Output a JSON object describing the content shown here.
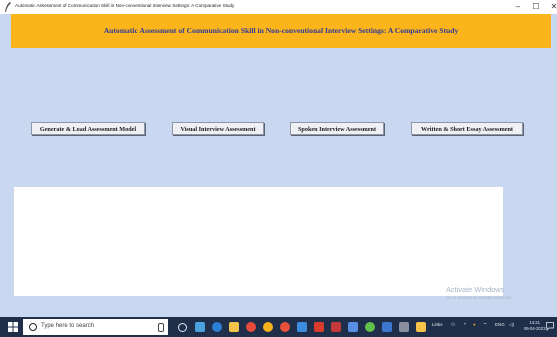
{
  "window": {
    "title": "Automatic Assessment of Communication Skill in Non-conventional Interview Settings: A Comparative Study",
    "minimize_glyph": "–",
    "maximize_glyph": "☐",
    "close_glyph": "✕"
  },
  "header": {
    "heading": "Automatic Assessment of Communication Skill in Non-conventional Interview Settings: A Comparative Study"
  },
  "buttons": {
    "generate_load": "Generate & Load Assessment Model",
    "visual": "Visual Interview Assessment",
    "spoken": "Spoken Interview Assessment",
    "written": "Written & Short Essay Assessment"
  },
  "watermark": {
    "line1": "Activate Windows",
    "line2": "Go to Settings to activate Windows."
  },
  "taskbar": {
    "search_placeholder": "Type here to search",
    "tray_text": "Links",
    "time": "14:21",
    "date": "06-04-2023"
  },
  "colors": {
    "banner": "#fbb419",
    "heading": "#2f3b9c",
    "background": "#c9d7f0",
    "taskbar": "#1f2f4a"
  }
}
